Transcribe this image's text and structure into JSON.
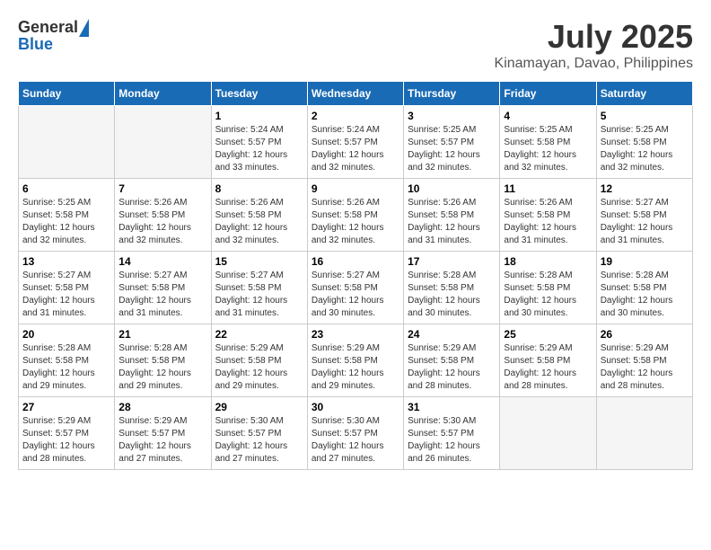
{
  "header": {
    "logo_general": "General",
    "logo_blue": "Blue",
    "month_year": "July 2025",
    "location": "Kinamayan, Davao, Philippines"
  },
  "days_of_week": [
    "Sunday",
    "Monday",
    "Tuesday",
    "Wednesday",
    "Thursday",
    "Friday",
    "Saturday"
  ],
  "weeks": [
    [
      {
        "day": "",
        "sunrise": "",
        "sunset": "",
        "daylight": ""
      },
      {
        "day": "",
        "sunrise": "",
        "sunset": "",
        "daylight": ""
      },
      {
        "day": "1",
        "sunrise": "Sunrise: 5:24 AM",
        "sunset": "Sunset: 5:57 PM",
        "daylight": "Daylight: 12 hours and 33 minutes."
      },
      {
        "day": "2",
        "sunrise": "Sunrise: 5:24 AM",
        "sunset": "Sunset: 5:57 PM",
        "daylight": "Daylight: 12 hours and 32 minutes."
      },
      {
        "day": "3",
        "sunrise": "Sunrise: 5:25 AM",
        "sunset": "Sunset: 5:57 PM",
        "daylight": "Daylight: 12 hours and 32 minutes."
      },
      {
        "day": "4",
        "sunrise": "Sunrise: 5:25 AM",
        "sunset": "Sunset: 5:58 PM",
        "daylight": "Daylight: 12 hours and 32 minutes."
      },
      {
        "day": "5",
        "sunrise": "Sunrise: 5:25 AM",
        "sunset": "Sunset: 5:58 PM",
        "daylight": "Daylight: 12 hours and 32 minutes."
      }
    ],
    [
      {
        "day": "6",
        "sunrise": "Sunrise: 5:25 AM",
        "sunset": "Sunset: 5:58 PM",
        "daylight": "Daylight: 12 hours and 32 minutes."
      },
      {
        "day": "7",
        "sunrise": "Sunrise: 5:26 AM",
        "sunset": "Sunset: 5:58 PM",
        "daylight": "Daylight: 12 hours and 32 minutes."
      },
      {
        "day": "8",
        "sunrise": "Sunrise: 5:26 AM",
        "sunset": "Sunset: 5:58 PM",
        "daylight": "Daylight: 12 hours and 32 minutes."
      },
      {
        "day": "9",
        "sunrise": "Sunrise: 5:26 AM",
        "sunset": "Sunset: 5:58 PM",
        "daylight": "Daylight: 12 hours and 32 minutes."
      },
      {
        "day": "10",
        "sunrise": "Sunrise: 5:26 AM",
        "sunset": "Sunset: 5:58 PM",
        "daylight": "Daylight: 12 hours and 31 minutes."
      },
      {
        "day": "11",
        "sunrise": "Sunrise: 5:26 AM",
        "sunset": "Sunset: 5:58 PM",
        "daylight": "Daylight: 12 hours and 31 minutes."
      },
      {
        "day": "12",
        "sunrise": "Sunrise: 5:27 AM",
        "sunset": "Sunset: 5:58 PM",
        "daylight": "Daylight: 12 hours and 31 minutes."
      }
    ],
    [
      {
        "day": "13",
        "sunrise": "Sunrise: 5:27 AM",
        "sunset": "Sunset: 5:58 PM",
        "daylight": "Daylight: 12 hours and 31 minutes."
      },
      {
        "day": "14",
        "sunrise": "Sunrise: 5:27 AM",
        "sunset": "Sunset: 5:58 PM",
        "daylight": "Daylight: 12 hours and 31 minutes."
      },
      {
        "day": "15",
        "sunrise": "Sunrise: 5:27 AM",
        "sunset": "Sunset: 5:58 PM",
        "daylight": "Daylight: 12 hours and 31 minutes."
      },
      {
        "day": "16",
        "sunrise": "Sunrise: 5:27 AM",
        "sunset": "Sunset: 5:58 PM",
        "daylight": "Daylight: 12 hours and 30 minutes."
      },
      {
        "day": "17",
        "sunrise": "Sunrise: 5:28 AM",
        "sunset": "Sunset: 5:58 PM",
        "daylight": "Daylight: 12 hours and 30 minutes."
      },
      {
        "day": "18",
        "sunrise": "Sunrise: 5:28 AM",
        "sunset": "Sunset: 5:58 PM",
        "daylight": "Daylight: 12 hours and 30 minutes."
      },
      {
        "day": "19",
        "sunrise": "Sunrise: 5:28 AM",
        "sunset": "Sunset: 5:58 PM",
        "daylight": "Daylight: 12 hours and 30 minutes."
      }
    ],
    [
      {
        "day": "20",
        "sunrise": "Sunrise: 5:28 AM",
        "sunset": "Sunset: 5:58 PM",
        "daylight": "Daylight: 12 hours and 29 minutes."
      },
      {
        "day": "21",
        "sunrise": "Sunrise: 5:28 AM",
        "sunset": "Sunset: 5:58 PM",
        "daylight": "Daylight: 12 hours and 29 minutes."
      },
      {
        "day": "22",
        "sunrise": "Sunrise: 5:29 AM",
        "sunset": "Sunset: 5:58 PM",
        "daylight": "Daylight: 12 hours and 29 minutes."
      },
      {
        "day": "23",
        "sunrise": "Sunrise: 5:29 AM",
        "sunset": "Sunset: 5:58 PM",
        "daylight": "Daylight: 12 hours and 29 minutes."
      },
      {
        "day": "24",
        "sunrise": "Sunrise: 5:29 AM",
        "sunset": "Sunset: 5:58 PM",
        "daylight": "Daylight: 12 hours and 28 minutes."
      },
      {
        "day": "25",
        "sunrise": "Sunrise: 5:29 AM",
        "sunset": "Sunset: 5:58 PM",
        "daylight": "Daylight: 12 hours and 28 minutes."
      },
      {
        "day": "26",
        "sunrise": "Sunrise: 5:29 AM",
        "sunset": "Sunset: 5:58 PM",
        "daylight": "Daylight: 12 hours and 28 minutes."
      }
    ],
    [
      {
        "day": "27",
        "sunrise": "Sunrise: 5:29 AM",
        "sunset": "Sunset: 5:57 PM",
        "daylight": "Daylight: 12 hours and 28 minutes."
      },
      {
        "day": "28",
        "sunrise": "Sunrise: 5:29 AM",
        "sunset": "Sunset: 5:57 PM",
        "daylight": "Daylight: 12 hours and 27 minutes."
      },
      {
        "day": "29",
        "sunrise": "Sunrise: 5:30 AM",
        "sunset": "Sunset: 5:57 PM",
        "daylight": "Daylight: 12 hours and 27 minutes."
      },
      {
        "day": "30",
        "sunrise": "Sunrise: 5:30 AM",
        "sunset": "Sunset: 5:57 PM",
        "daylight": "Daylight: 12 hours and 27 minutes."
      },
      {
        "day": "31",
        "sunrise": "Sunrise: 5:30 AM",
        "sunset": "Sunset: 5:57 PM",
        "daylight": "Daylight: 12 hours and 26 minutes."
      },
      {
        "day": "",
        "sunrise": "",
        "sunset": "",
        "daylight": ""
      },
      {
        "day": "",
        "sunrise": "",
        "sunset": "",
        "daylight": ""
      }
    ]
  ]
}
